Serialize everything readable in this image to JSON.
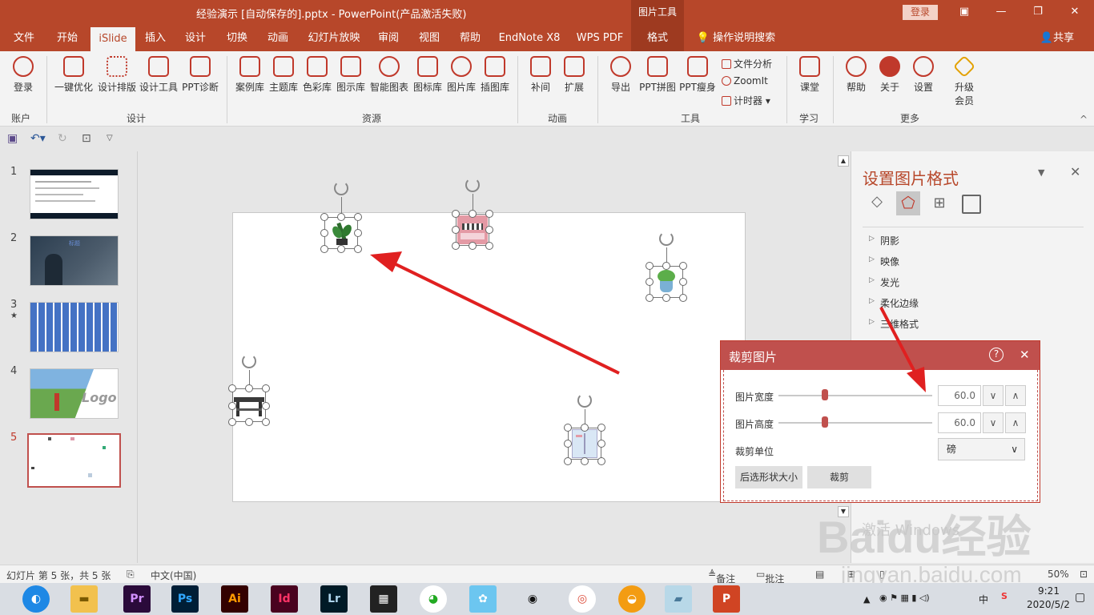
{
  "window": {
    "doc_title": "经验演示 [自动保存的].pptx  -  PowerPoint(产品激活失败)",
    "picture_tools": "图片工具",
    "login": "登录",
    "ctrl_icon": "▣",
    "min": "—",
    "max": "❐",
    "close": "✕"
  },
  "menu": {
    "tabs": [
      "文件",
      "开始",
      "iSlide",
      "插入",
      "设计",
      "切换",
      "动画",
      "幻灯片放映",
      "审阅",
      "视图",
      "帮助",
      "EndNote X8",
      "WPS PDF",
      "格式"
    ],
    "tellme": "操作说明搜索",
    "share": "共享"
  },
  "ribbon": {
    "account": {
      "login": "登录",
      "group": "账户"
    },
    "design": {
      "onekey": "一键优化",
      "layout": "设计排版",
      "tools": "设计工具",
      "diag": "PPT诊断",
      "group": "设计"
    },
    "resources": {
      "cases": "案例库",
      "themes": "主题库",
      "colors": "色彩库",
      "diagrams": "图示库",
      "smartchart": "智能图表",
      "icons": "图标库",
      "pics": "图片库",
      "illus": "插图库",
      "group": "资源"
    },
    "animation": {
      "tween": "补间",
      "extend": "扩展",
      "group": "动画"
    },
    "tools": {
      "export": "导出",
      "pptmosaic": "PPT拼图",
      "pptslim": "PPT瘦身",
      "fileanalysis": "文件分析",
      "zoomit": "ZoomIt",
      "timer": "计时器",
      "group": "工具"
    },
    "learn": {
      "course": "课堂",
      "group": "学习"
    },
    "more": {
      "help": "帮助",
      "about": "关于",
      "settings": "设置",
      "upgrade1": "升级",
      "upgrade2": "会员",
      "group": "更多"
    }
  },
  "slides": {
    "numbers": [
      "1",
      "2",
      "3",
      "4",
      "5"
    ],
    "star": "★",
    "logo_text": "Logo",
    "blue_text": "标题"
  },
  "format_pane": {
    "title": "设置图片格式",
    "items": [
      "阴影",
      "映像",
      "发光",
      "柔化边缘",
      "三维格式"
    ]
  },
  "crop_dialog": {
    "title": "裁剪图片",
    "help": "?",
    "close": "✕",
    "width_label": "图片宽度",
    "width_value": "60.0",
    "width_slider": 0.35,
    "height_label": "图片高度",
    "height_value": "60.0",
    "height_slider": 0.35,
    "unit_label": "裁剪单位",
    "unit_value": "磅",
    "btn_fit": "后选形状大小",
    "btn_crop": "裁剪",
    "down": "∨",
    "up": "∧",
    "dd_arrow": "∨"
  },
  "statusbar": {
    "slide_info": "幻灯片 第 5 张，共 5 张",
    "language": "中文(中国)",
    "notes": "备注",
    "comments": "批注",
    "zoom": "50%"
  },
  "taskbar": {
    "apps": [
      "Pr",
      "Ps",
      "Ai",
      "Id",
      "Lr"
    ],
    "time": "9:21",
    "date": "2020/5/2",
    "ime": "中"
  },
  "watermark": {
    "baidu": "Baidu经验",
    "url": "jingyan.baidu.com",
    "activate": "激活 Windows"
  },
  "colors": {
    "accent": "#b7472a",
    "dialog_header": "#c0504d"
  }
}
